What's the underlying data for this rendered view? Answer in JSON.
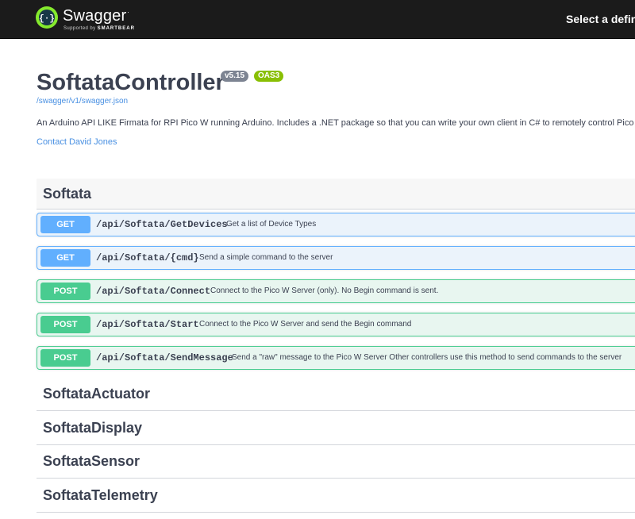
{
  "colors": {
    "topbar": "#1b1b1b",
    "logo_green": "#85ea2d",
    "get": "#61affe",
    "post": "#49cc90",
    "link": "#4990e2",
    "version_badge": "#7d8492",
    "oas_badge": "#89bf04"
  },
  "topbar": {
    "logo_text": "Swagger",
    "logo_tm": ".",
    "logo_supported_by": "Supported by",
    "logo_company": "SMARTBEAR",
    "logo_icon": "swagger-braces-icon",
    "select_definition_label": "Select a definit"
  },
  "info": {
    "title": "SoftataController",
    "version": "v5.15",
    "oas": "OAS3",
    "spec_url": "/swagger/v1/swagger.json",
    "description": "An Arduino API LIKE Firmata for RPI Pico W running Arduino. Includes a .NET package so that you can write your own client in C# to remotely control Pico W",
    "contact": "Contact David Jones"
  },
  "tags": [
    {
      "name": "Softata",
      "expanded": true,
      "operations": [
        {
          "method": "GET",
          "path": "/api/Softata/GetDevices",
          "summary": "Get a list of Device Types"
        },
        {
          "method": "GET",
          "path": "/api/Softata/{cmd}",
          "summary": "Send a simple command to the server"
        },
        {
          "method": "POST",
          "path": "/api/Softata/Connect",
          "summary": "Connect to the Pico W Server (only). No Begin command is sent."
        },
        {
          "method": "POST",
          "path": "/api/Softata/Start",
          "summary": "Connect to the Pico W Server and send the Begin command"
        },
        {
          "method": "POST",
          "path": "/api/Softata/SendMessage",
          "summary": "Send a \"raw\" message to the Pico W Server Other controllers use this method to send commands to the server"
        }
      ]
    },
    {
      "name": "SoftataActuator",
      "expanded": false
    },
    {
      "name": "SoftataDisplay",
      "expanded": false
    },
    {
      "name": "SoftataSensor",
      "expanded": false
    },
    {
      "name": "SoftataTelemetry",
      "expanded": false
    }
  ]
}
